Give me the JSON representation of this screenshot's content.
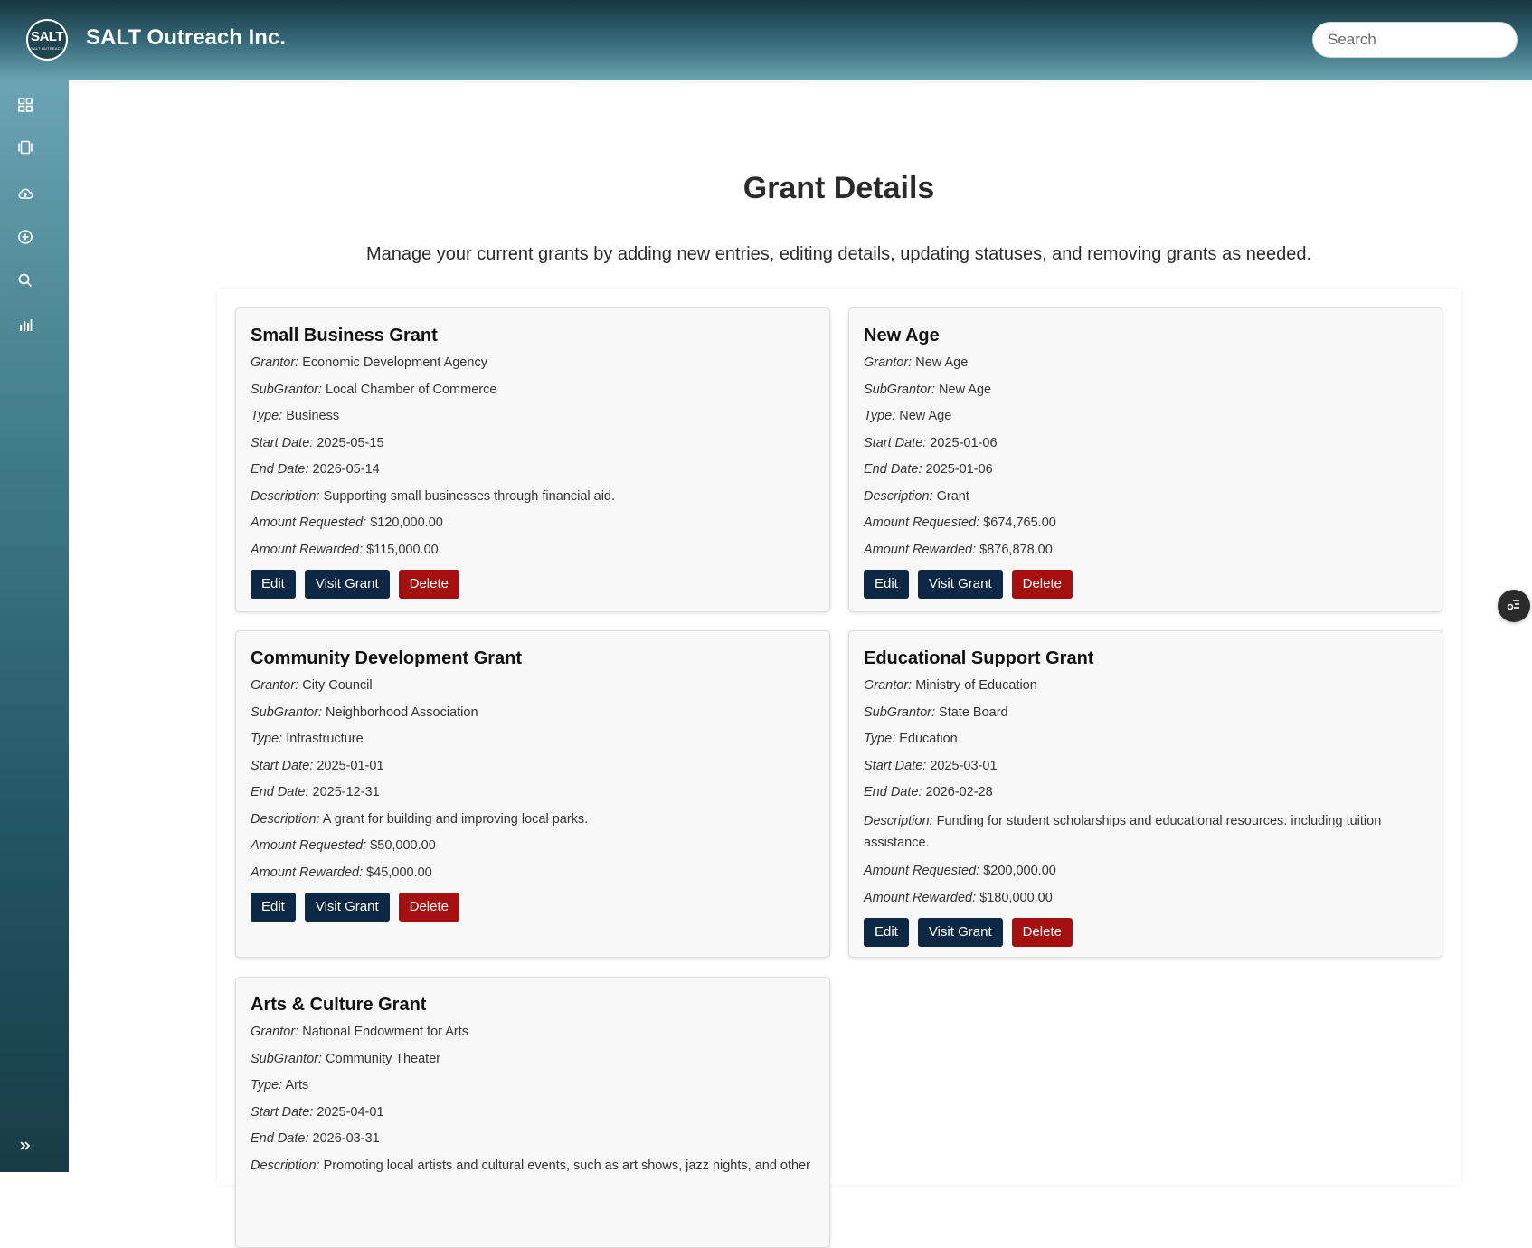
{
  "header": {
    "logo_text": "SALT",
    "logo_subtext": "SALT OUTREACH",
    "app_title": "SALT Outreach Inc.",
    "search_placeholder": "Search"
  },
  "sidebar": {
    "items": [
      {
        "icon": "dashboard-grid-icon"
      },
      {
        "icon": "grants-icon"
      },
      {
        "icon": "cloud-upload-icon"
      },
      {
        "icon": "add-circle-icon"
      },
      {
        "icon": "search-icon"
      },
      {
        "icon": "bar-chart-icon"
      }
    ],
    "expand_icon": "double-chevron-right-icon"
  },
  "page": {
    "title": "Grant Details",
    "subtitle": "Manage your current grants by adding new entries, editing details, updating statuses, and removing grants as needed."
  },
  "labels": {
    "grantor": "Grantor:",
    "subgrantor": "SubGrantor:",
    "type": "Type:",
    "start_date": "Start Date:",
    "end_date": "End Date:",
    "description": "Description:",
    "amount_requested": "Amount Requested:",
    "amount_rewarded": "Amount Rewarded:",
    "edit_button": "Edit",
    "visit_button": "Visit Grant",
    "delete_button": "Delete"
  },
  "colors": {
    "primary_button": "#0c2845",
    "delete_button": "#a50f0f"
  },
  "grants": [
    {
      "name": "Small Business Grant",
      "grantor": "Economic Development Agency",
      "subgrantor": "Local Chamber of Commerce",
      "type": "Business",
      "start_date": "2025-05-15",
      "end_date": "2026-05-14",
      "description": "Supporting small businesses through financial aid.",
      "amount_requested": "$120,000.00",
      "amount_rewarded": "$115,000.00"
    },
    {
      "name": "New Age",
      "grantor": "New Age",
      "subgrantor": "New Age",
      "type": "New Age",
      "start_date": "2025-01-06",
      "end_date": "2025-01-06",
      "description": "Grant",
      "amount_requested": "$674,765.00",
      "amount_rewarded": "$876,878.00"
    },
    {
      "name": "Community Development Grant",
      "grantor": "City Council",
      "subgrantor": "Neighborhood Association",
      "type": "Infrastructure",
      "start_date": "2025-01-01",
      "end_date": "2025-12-31",
      "description": "A grant for building and improving local parks.",
      "amount_requested": "$50,000.00",
      "amount_rewarded": "$45,000.00"
    },
    {
      "name": "Educational Support Grant",
      "grantor": "Ministry of Education",
      "subgrantor": "State Board",
      "type": "Education",
      "start_date": "2025-03-01",
      "end_date": "2026-02-28",
      "description": "Funding for student scholarships and educational resources. including tuition assistance.",
      "amount_requested": "$200,000.00",
      "amount_rewarded": "$180,000.00"
    },
    {
      "name": "Arts & Culture Grant",
      "grantor": "National Endowment for Arts",
      "subgrantor": "Community Theater",
      "type": "Arts",
      "start_date": "2025-04-01",
      "end_date": "2026-03-31",
      "description": "Promoting local artists and cultural events, such as art shows, jazz nights, and other"
    }
  ],
  "floating_button": {
    "icon": "settings-list-icon"
  }
}
